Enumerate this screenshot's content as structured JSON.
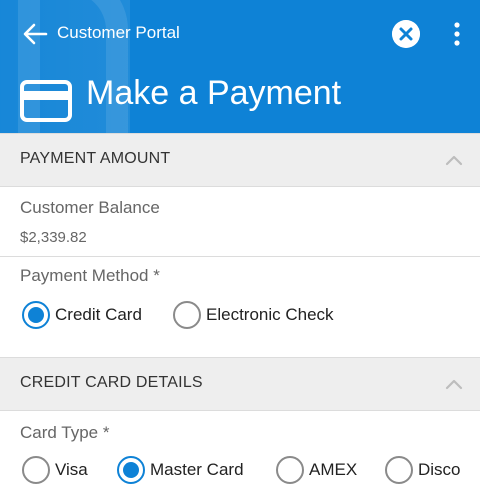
{
  "header": {
    "back_label": "Customer Portal",
    "title": "Make a Payment",
    "bg_color": "#0e82d6",
    "icons": [
      "arrow-left-icon",
      "close-icon",
      "more-vertical-icon",
      "credit-card-icon"
    ]
  },
  "payment_amount": {
    "section_title": "PAYMENT AMOUNT",
    "balance_label": "Customer Balance",
    "balance_value": "$2,339.82",
    "method_label": "Payment Method *",
    "methods": [
      {
        "label": "Credit Card",
        "selected": true
      },
      {
        "label": "Electronic Check",
        "selected": false
      }
    ]
  },
  "credit_card_details": {
    "section_title": "CREDIT CARD DETAILS",
    "card_type_label": "Card Type *",
    "card_types": [
      {
        "label": "Visa",
        "selected": false
      },
      {
        "label": "Master Card",
        "selected": true
      },
      {
        "label": "AMEX",
        "selected": false
      },
      {
        "label": "Disco",
        "selected": false
      }
    ]
  }
}
